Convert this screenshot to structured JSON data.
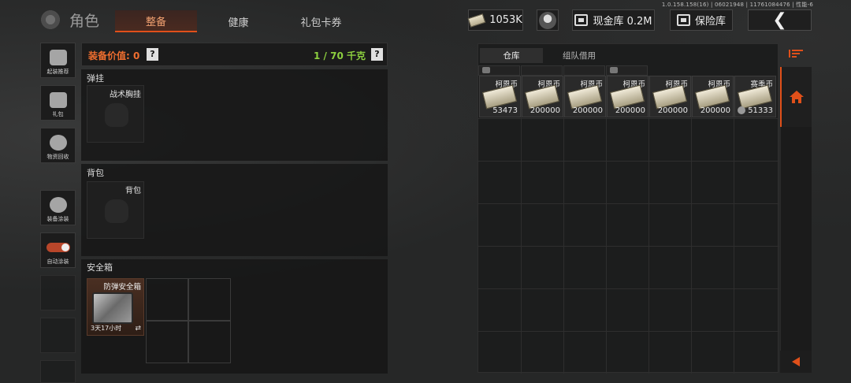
{
  "version_info": "1.0.158.158(16) | 06021948 | 11761084476 | 性能-6",
  "header": {
    "title": "角色",
    "tabs": [
      {
        "label": "整备",
        "active": true
      },
      {
        "label": "健康",
        "active": false
      },
      {
        "label": "礼包卡券",
        "active": false
      }
    ],
    "currency": "1053K",
    "cash_vault": "现金库 0.2M",
    "safe_box": "保险库",
    "back_icon": "chevron-left-icon"
  },
  "sidebar": {
    "items": [
      {
        "label": "起装推荐",
        "icon": "loadout-icon"
      },
      {
        "label": "礼包",
        "icon": "gift-icon"
      },
      {
        "label": "物资回收",
        "icon": "recycle-icon"
      },
      {
        "label": "装备涂装",
        "icon": "paint-icon"
      },
      {
        "label": "自动涂装",
        "icon": "toggle-icon",
        "toggle_on": true
      }
    ]
  },
  "loadout": {
    "value_label": "装备价值: 0",
    "weight_label": "1 / 70 千克",
    "help": "?",
    "sections": [
      {
        "title": "弹挂",
        "slot_label": "战术胸挂"
      },
      {
        "title": "背包",
        "slot_label": "背包"
      },
      {
        "title": "安全箱",
        "slot_label": "防弹安全箱",
        "timer": "3天17小时",
        "swap": "⇄"
      }
    ]
  },
  "stash": {
    "tabs": [
      {
        "label": "仓库",
        "active": true
      },
      {
        "label": "组队借用",
        "active": false
      }
    ],
    "items": [
      {
        "name": "柯恩币",
        "qty": "53473"
      },
      {
        "name": "柯恩币",
        "qty": "200000"
      },
      {
        "name": "柯恩币",
        "qty": "200000"
      },
      {
        "name": "柯恩币",
        "qty": "200000"
      },
      {
        "name": "柯恩币",
        "qty": "200000"
      },
      {
        "name": "柯恩币",
        "qty": "200000"
      },
      {
        "name": "赛季币",
        "qty": "51333"
      }
    ]
  },
  "colors": {
    "accent": "#e0501a",
    "value_orange": "#ef6e2f",
    "weight_green": "#8ccf3f"
  }
}
